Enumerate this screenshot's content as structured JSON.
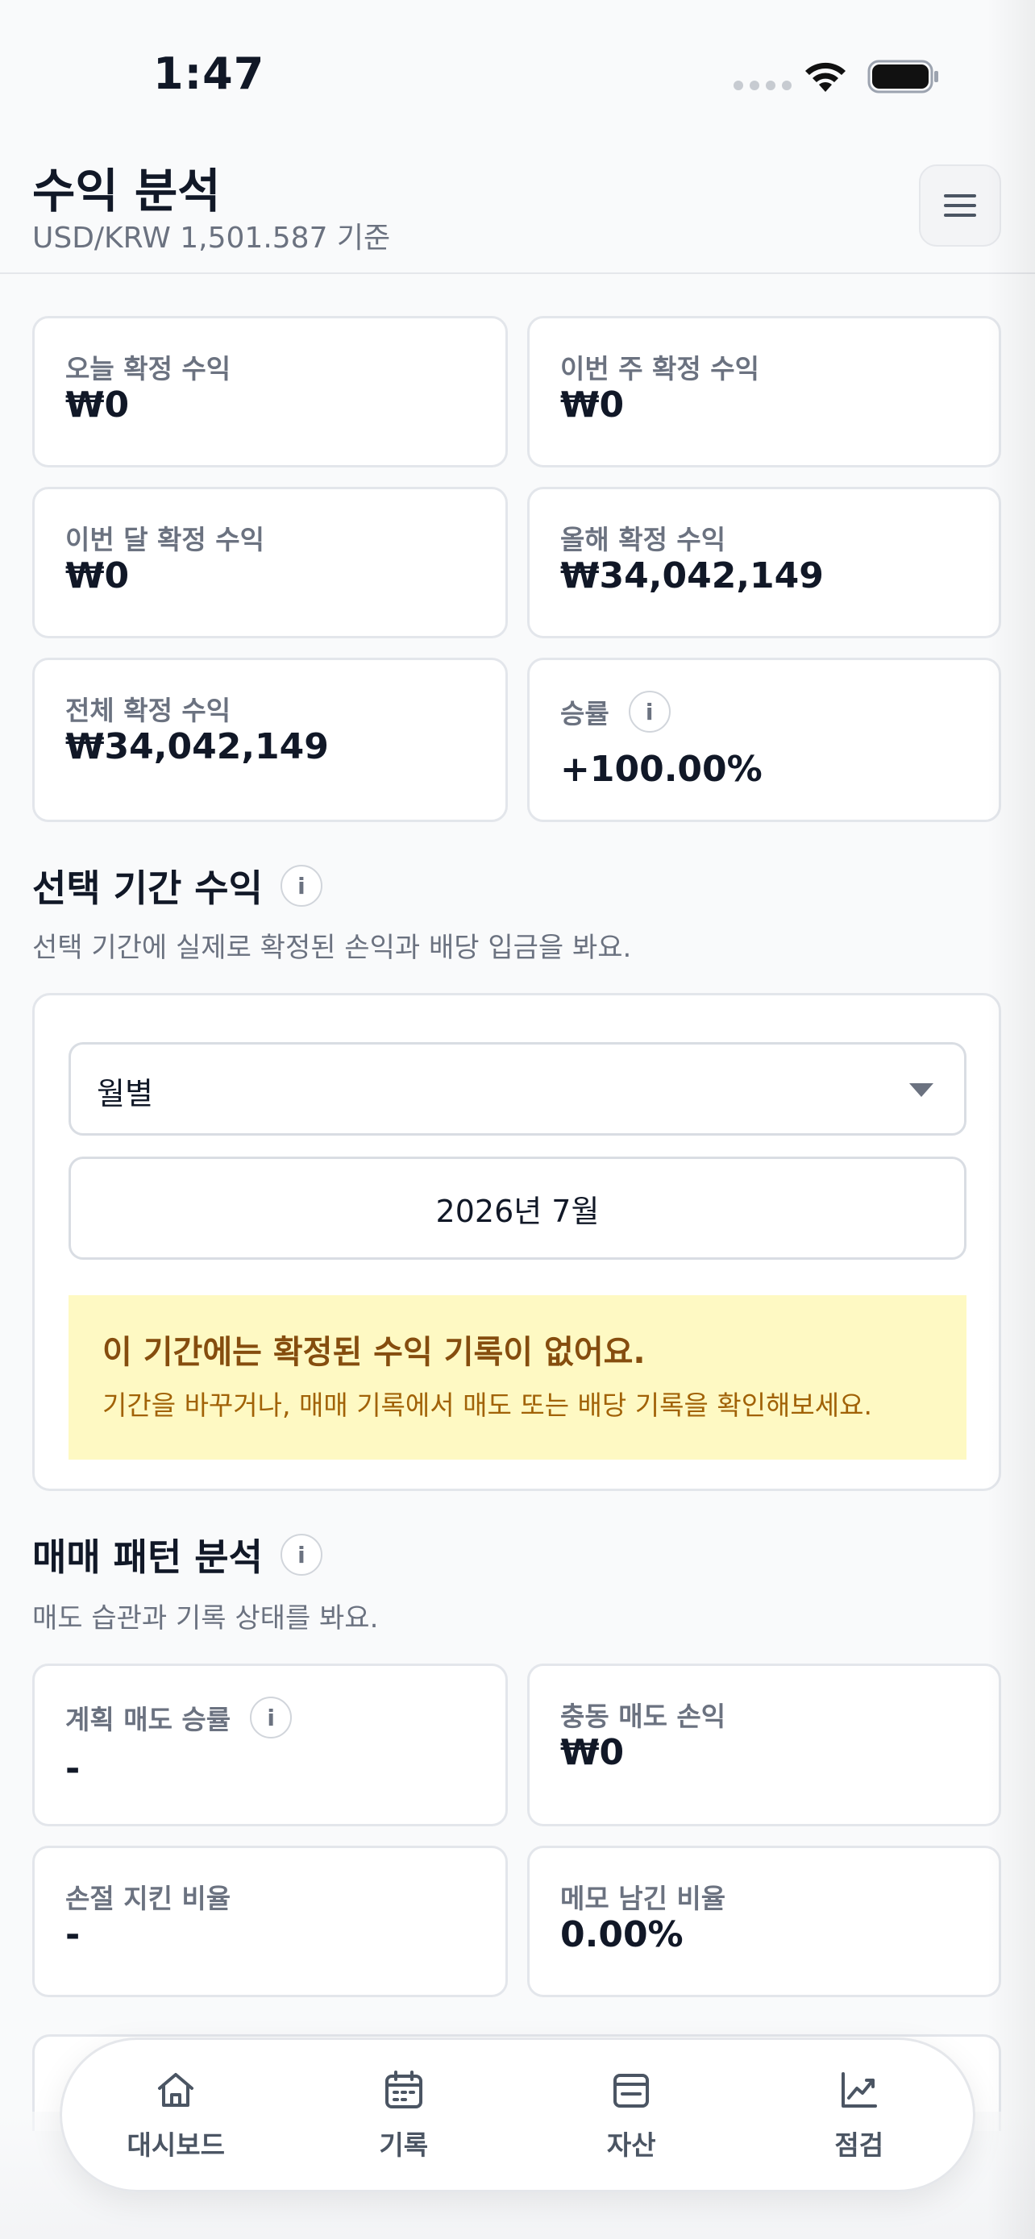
{
  "status_bar": {
    "time": "1:47"
  },
  "header": {
    "title": "수익 분석",
    "fx_rate": "USD/KRW 1,501.587 기준"
  },
  "summary_cards": [
    {
      "label": "오늘 확정 수익",
      "value": "₩0"
    },
    {
      "label": "이번 주 확정 수익",
      "value": "₩0"
    },
    {
      "label": "이번 달 확정 수익",
      "value": "₩0"
    },
    {
      "label": "올해 확정 수익",
      "value": "₩34,042,149"
    },
    {
      "label": "전체 확정 수익",
      "value": "₩34,042,149"
    },
    {
      "label": "승률",
      "value": "+100.00%"
    }
  ],
  "period_section": {
    "title": "선택 기간 수익",
    "description": "선택 기간에 실제로 확정된 손익과 배당 입금을 봐요.",
    "period_select": "월별",
    "date_value": "2026년 7월",
    "notice_title": "이 기간에는 확정된 수익 기록이 없어요.",
    "notice_body": "기간을 바꾸거나, 매매 기록에서 매도 또는 배당 기록을 확인해보세요."
  },
  "pattern_section": {
    "title": "매매 패턴 분석",
    "description": "매도 습관과 기록 상태를 봐요.",
    "cards": [
      {
        "label": "계획 매도 승률",
        "value": "-"
      },
      {
        "label": "충동 매도 손익",
        "value": "₩0"
      },
      {
        "label": "손절 지킨 비율",
        "value": "-"
      },
      {
        "label": "메모 남긴 비율",
        "value": "0.00%"
      }
    ]
  },
  "info_glyph": "i",
  "bottom_nav": [
    {
      "label": "대시보드",
      "icon": "home-icon"
    },
    {
      "label": "기록",
      "icon": "calendar-icon"
    },
    {
      "label": "자산",
      "icon": "wallet-icon"
    },
    {
      "label": "점검",
      "icon": "chart-icon"
    }
  ]
}
